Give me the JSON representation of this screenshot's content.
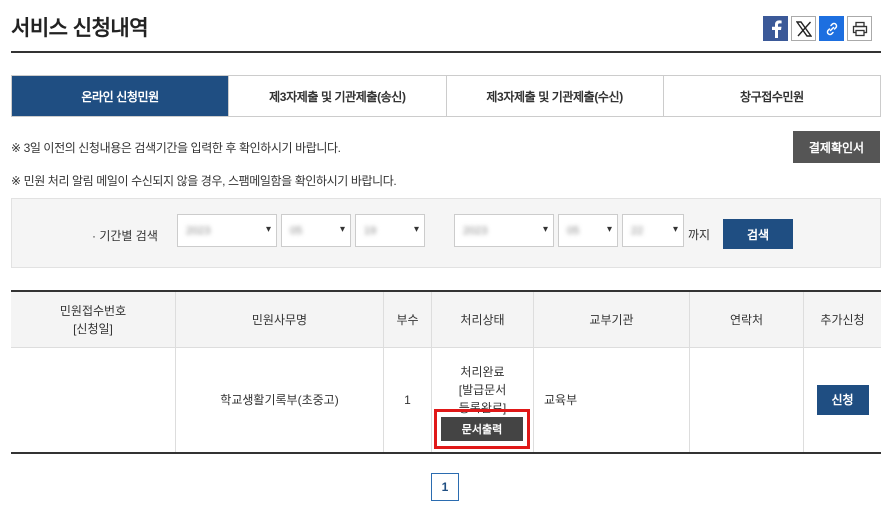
{
  "header": {
    "title": "서비스 신청내역",
    "share_icons": [
      "facebook-icon",
      "x-icon",
      "link-icon",
      "print-icon"
    ]
  },
  "tabs": [
    {
      "label": "온라인 신청민원",
      "active": true
    },
    {
      "label": "제3자제출 및 기관제출(송신)",
      "active": false
    },
    {
      "label": "제3자제출 및 기관제출(수신)",
      "active": false
    },
    {
      "label": "창구접수민원",
      "active": false
    }
  ],
  "notices": [
    "※ 3일 이전의 신청내용은 검색기간을 입력한 후 확인하시기 바랍니다.",
    "※ 민원 처리 알림 메일이 수신되지 않을 경우, 스팸메일함을 확인하시기 바랍니다."
  ],
  "payment_button": "결제확인서",
  "search": {
    "label": "· 기간별 검색",
    "start": {
      "year": "2023",
      "month": "05",
      "day": "19"
    },
    "end": {
      "year": "2023",
      "month": "05",
      "day": "22"
    },
    "until_label": "까지",
    "button": "검색"
  },
  "table": {
    "headers": [
      "민원접수번호",
      "[신청일]",
      "민원사무명",
      "부수",
      "처리상태",
      "교부기관",
      "연락처",
      "추가신청"
    ],
    "rows": [
      {
        "receipt": "",
        "name": "학교생활기록부(초중고)",
        "copies": "1",
        "status_lines": [
          "처리완료",
          "[발급문서",
          "등록완료]"
        ],
        "print_button": "문서출력",
        "agency": "교육부",
        "contact": "",
        "apply_button": "신청"
      }
    ]
  },
  "pagination": {
    "current": "1"
  },
  "colors": {
    "primary": "#1f4e82",
    "highlight": "#e01818",
    "dark_button": "#444444"
  }
}
